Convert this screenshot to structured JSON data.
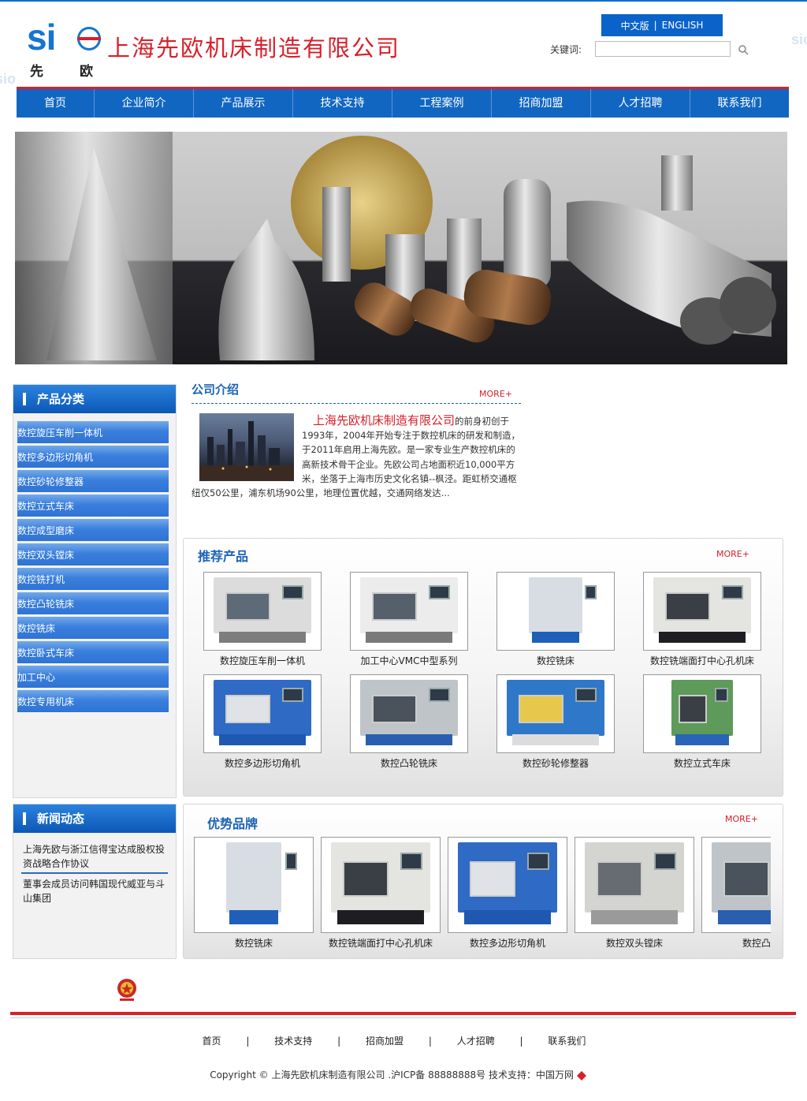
{
  "header": {
    "company_name": "上海先欧机床制造有限公司",
    "logo_letters": "si",
    "logo_cn_1": "先",
    "logo_cn_2": "欧",
    "lang_cn": "中文版",
    "lang_sep": "|",
    "lang_en": "ENGLISH",
    "search_label": "关键词:",
    "search_value": "",
    "search_placeholder": ""
  },
  "nav": [
    "首页",
    "企业简介",
    "产品展示",
    "技术支持",
    "工程案例",
    "招商加盟",
    "人才招聘",
    "联系我们"
  ],
  "sidebar": {
    "categories_title": "产品分类",
    "categories": [
      "数控旋压车削一体机",
      "数控多边形切角机",
      "数控砂轮修整器",
      "数控立式车床",
      "数控成型磨床",
      "数控双头镗床",
      "数控铣打机",
      "数控凸轮铣床",
      "数控铣床",
      "数控卧式车床",
      "加工中心",
      "数控专用机床"
    ],
    "news_title": "新闻动态",
    "news": [
      "上海先欧与浙江信得宝达成股权投资战略合作协议",
      "董事会成员访问韩国现代威亚与斗山集团"
    ]
  },
  "intro": {
    "title": "公司介绍",
    "more": "MORE+",
    "name": "上海先欧机床制造有限公司",
    "text": "的前身初创于1993年，2004年开始专注于数控机床的研发和制造，于2011年启用上海先欧。是一家专业生产数控机床的高新技术骨干企业。先欧公司占地面积近10,000平方米，坐落于上海市历史文化名镇--枫泾。距虹桥交通枢纽仅50公里，浦东机场90公里，地理位置优越，交通网络发达..."
  },
  "recommended": {
    "title": "推荐产品",
    "more": "MORE+",
    "items": [
      "数控旋压车削一体机",
      "加工中心VMC中型系列",
      "数控铣床",
      "数控铣端面打中心孔机床",
      "数控多边形切角机",
      "数控凸轮铣床",
      "数控砂轮修整器",
      "数控立式车床"
    ]
  },
  "brands": {
    "title": "优势品牌",
    "more": "MORE+",
    "items": [
      "数控铣床",
      "数控铣端面打中心孔机床",
      "数控多边形切角机",
      "数控双头镗床",
      "数控凸轮"
    ]
  },
  "footer": {
    "nav": [
      "首页",
      "技术支持",
      "招商加盟",
      "人才招聘",
      "联系我们"
    ],
    "separator": "|",
    "copyright": "Copyright © 上海先欧机床制造有限公司 .沪ICP备 88888888号  技术支持：中国万网"
  },
  "colors": {
    "primary_blue": "#1166c2",
    "accent_red": "#d8202a",
    "title_blue": "#1b62b8"
  }
}
